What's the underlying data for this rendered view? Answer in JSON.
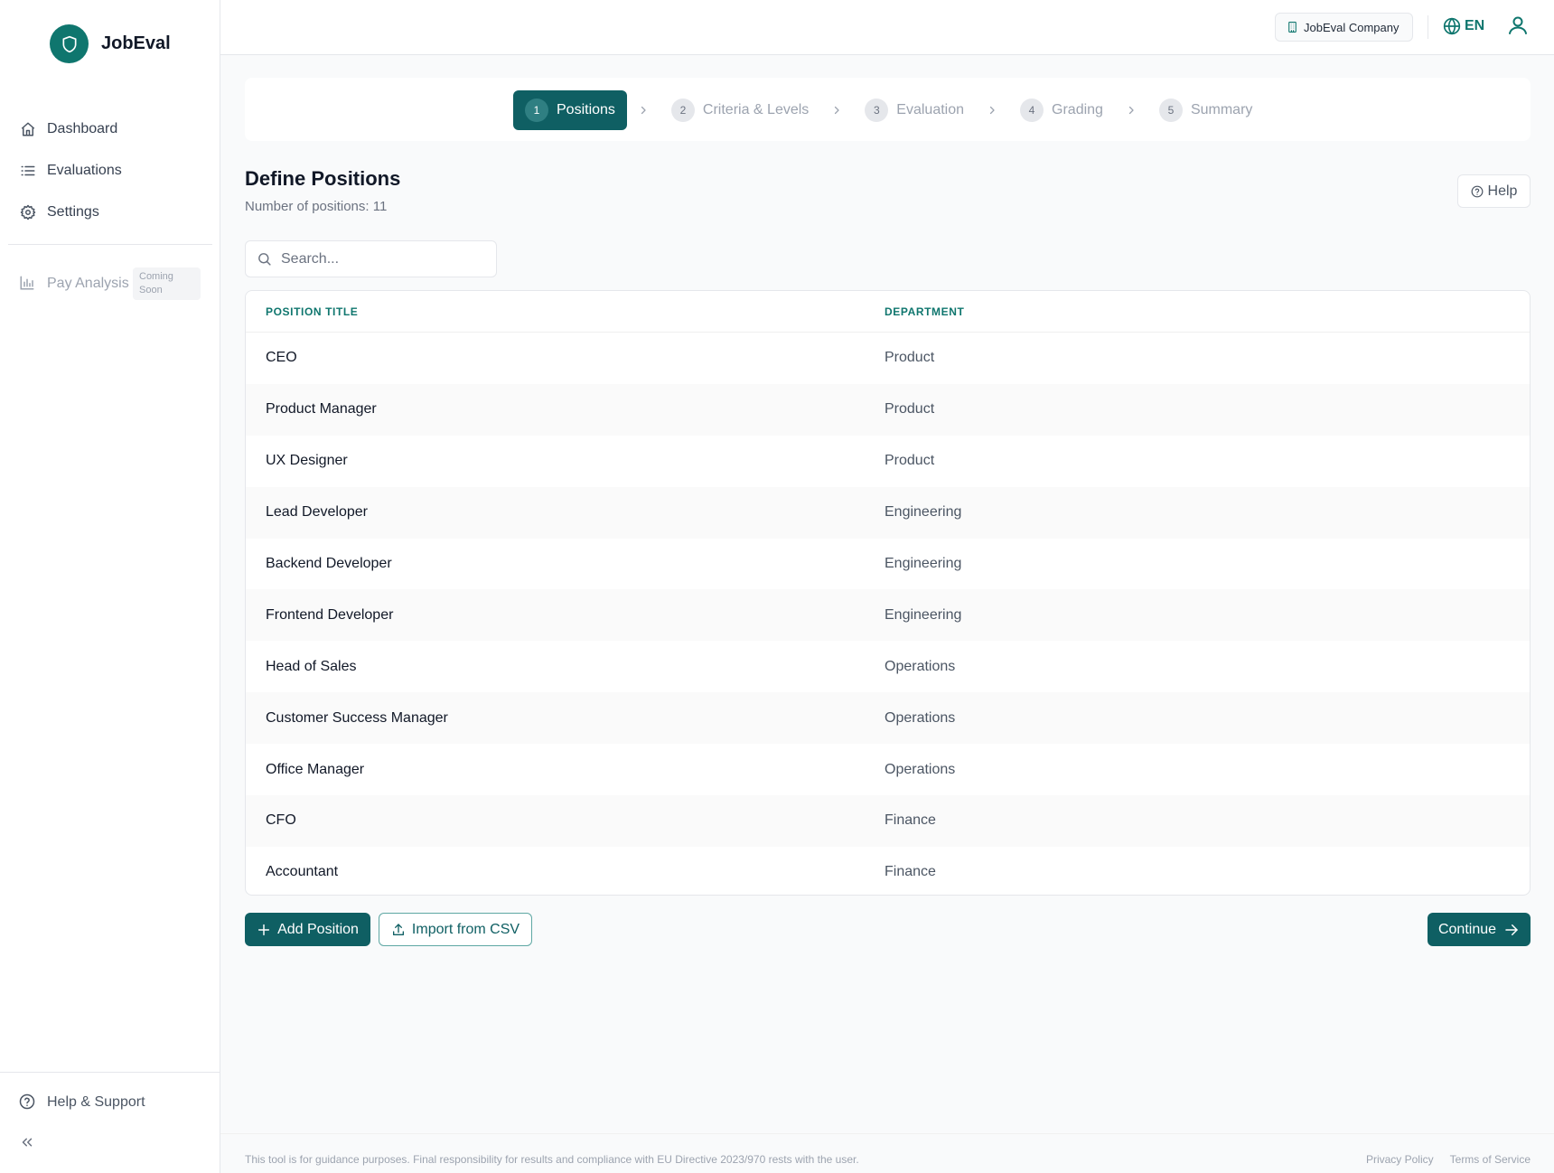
{
  "app": {
    "name": "JobEval"
  },
  "sidebar": {
    "items": [
      {
        "label": "Dashboard",
        "icon": "home-icon"
      },
      {
        "label": "Evaluations",
        "icon": "list-icon"
      },
      {
        "label": "Settings",
        "icon": "gear-icon"
      }
    ],
    "pay_analysis": {
      "label": "Pay Analysis",
      "badge": "Coming Soon"
    },
    "help_support": "Help & Support",
    "collapse_icon": "double-chevron-left-icon"
  },
  "topbar": {
    "company": "JobEval Company",
    "language": "EN"
  },
  "stepper": {
    "steps": [
      {
        "num": "1",
        "label": "Positions",
        "active": true
      },
      {
        "num": "2",
        "label": "Criteria & Levels",
        "active": false
      },
      {
        "num": "3",
        "label": "Evaluation",
        "active": false
      },
      {
        "num": "4",
        "label": "Grading",
        "active": false
      },
      {
        "num": "5",
        "label": "Summary",
        "active": false
      }
    ]
  },
  "main": {
    "title": "Define Positions",
    "subtitle": "Number of positions: 11",
    "help_label": "Help",
    "search_placeholder": "Search...",
    "table": {
      "headers": [
        "POSITION TITLE",
        "DEPARTMENT"
      ],
      "rows": [
        [
          "CEO",
          "Product"
        ],
        [
          "Product Manager",
          "Product"
        ],
        [
          "UX Designer",
          "Product"
        ],
        [
          "Lead Developer",
          "Engineering"
        ],
        [
          "Backend Developer",
          "Engineering"
        ],
        [
          "Frontend Developer",
          "Engineering"
        ],
        [
          "Head of Sales",
          "Operations"
        ],
        [
          "Customer Success Manager",
          "Operations"
        ],
        [
          "Office Manager",
          "Operations"
        ],
        [
          "CFO",
          "Finance"
        ],
        [
          "Accountant",
          "Finance"
        ]
      ]
    },
    "add_button": "Add Position",
    "import_button": "Import from CSV",
    "continue_button": "Continue"
  },
  "footer": {
    "note": "This tool is for guidance purposes. Final responsibility for results and compliance with EU Directive 2023/970 rests with the user.",
    "links": [
      "Privacy Policy",
      "Terms of Service"
    ]
  },
  "colors": {
    "brand": "#0f766e",
    "primary_button": "#0f5f63",
    "header_text": "#0f766e"
  }
}
